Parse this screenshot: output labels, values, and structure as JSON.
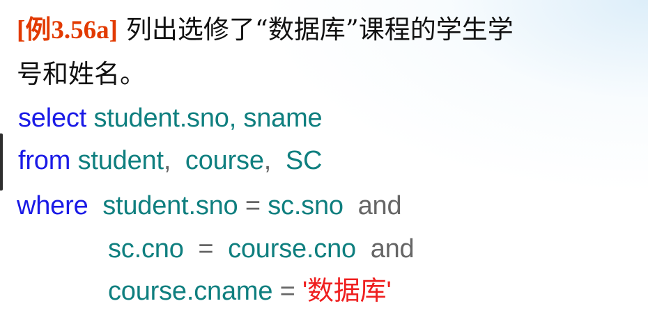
{
  "slide": {
    "example_tag": "[例3.56a]",
    "title_line1_text": "列出选修了“数据库”课程的学生学",
    "title_line2_text": "号和姓名。"
  },
  "sql": {
    "line1": {
      "select_keyword": "select",
      "columns": "student.sno, sname"
    },
    "line2": {
      "from_keyword": "from",
      "table1": "student",
      "comma1": ",",
      "table2": "course",
      "comma2": ",",
      "table3": "SC"
    },
    "line3": {
      "where_keyword": "where",
      "left_expr": "student.sno",
      "equals": "=",
      "right_expr": "sc.sno",
      "and_keyword": "and"
    },
    "line4": {
      "left_expr": "sc.cno",
      "equals": "=",
      "right_expr": "course.cno",
      "and_keyword": "and"
    },
    "line5": {
      "left_expr": "course.cname",
      "equals": "=",
      "string_literal": "'数据库'"
    }
  },
  "colors": {
    "title_tag": "#e23a00",
    "keyword": "#1a1ae6",
    "identifier": "#0f7f7f",
    "operator": "#666666",
    "string_literal": "#ef1f1f",
    "text": "#111111"
  }
}
